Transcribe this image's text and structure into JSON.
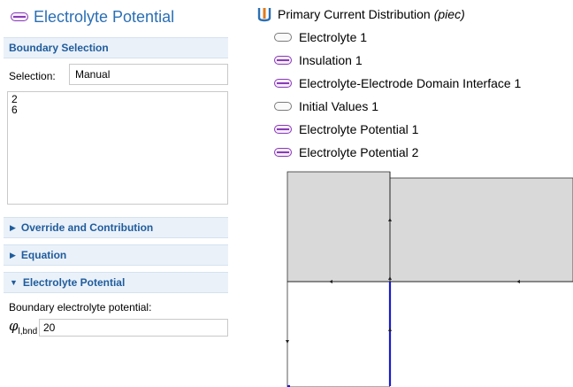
{
  "settings": {
    "title": "Electrolyte Potential",
    "boundary_selection": {
      "header": "Boundary Selection",
      "selection_label": "Selection:",
      "selection_value": "Manual",
      "entities": [
        "2",
        "6"
      ]
    },
    "sections": [
      {
        "label": "Override and Contribution",
        "expanded": false
      },
      {
        "label": "Equation",
        "expanded": false
      },
      {
        "label": "Electrolyte Potential",
        "expanded": true
      }
    ],
    "electrolyte_potential": {
      "field_label": "Boundary electrolyte potential:",
      "symbol": "φ",
      "symbol_subscript": "l,bnd",
      "value": "20"
    }
  },
  "model_tree": {
    "root": {
      "label": "Primary Current Distribution",
      "tag": "(piec)",
      "icon": "physics-interface-icon"
    },
    "items": [
      {
        "label": "Electrolyte 1",
        "icon": "domain-node-icon"
      },
      {
        "label": "Insulation 1",
        "icon": "boundary-node-icon"
      },
      {
        "label": "Electrolyte-Electrode Domain Interface 1",
        "icon": "boundary-node-icon"
      },
      {
        "label": "Initial Values 1",
        "icon": "domain-node-icon"
      },
      {
        "label": "Electrolyte Potential 1",
        "icon": "boundary-node-icon"
      },
      {
        "label": "Electrolyte Potential 2",
        "icon": "boundary-node-icon"
      }
    ]
  },
  "colors": {
    "title_blue": "#2a6fb5",
    "section_bg": "#eaf1f9",
    "selected_domain_gray": "#d9d9d9",
    "boundary_highlight": "#1a1acc",
    "node_purple": "#8a3ab8"
  }
}
